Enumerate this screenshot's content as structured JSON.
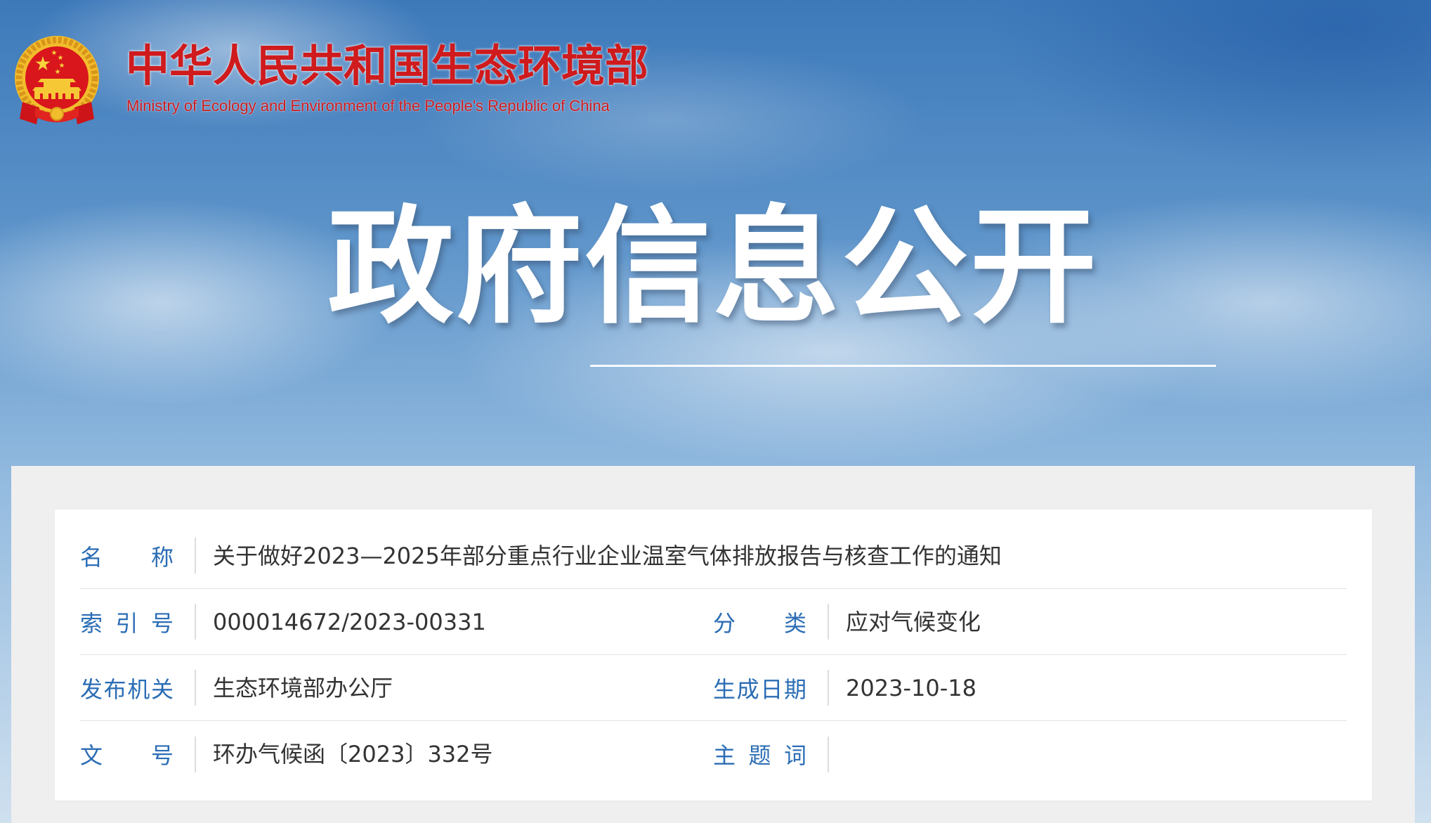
{
  "header": {
    "title_cn": "中华人民共和国生态环境部",
    "title_en": "Ministry of Ecology and Environment of the People's Republic of China",
    "banner_title": "政府信息公开"
  },
  "icons": {
    "emblem": "national-emblem-icon"
  },
  "info": {
    "name": {
      "label": "名 称",
      "value": "关于做好2023—2025年部分重点行业企业温室气体排放报告与核查工作的通知"
    },
    "index_no": {
      "label": "索 引 号",
      "value": "000014672/2023-00331"
    },
    "category": {
      "label": "分 类",
      "value": "应对气候变化"
    },
    "issuer": {
      "label": "发布机关",
      "value": "生态环境部办公厅"
    },
    "date": {
      "label": "生成日期",
      "value": "2023-10-18"
    },
    "doc_no": {
      "label": "文 号",
      "value": "环办气候函〔2023〕332号"
    },
    "keywords": {
      "label": "主 题 词",
      "value": ""
    }
  },
  "colors": {
    "brand_red": "#cf1b1d",
    "label_blue": "#2b6db5",
    "value_text": "#333333",
    "panel_gray": "#efefef"
  }
}
